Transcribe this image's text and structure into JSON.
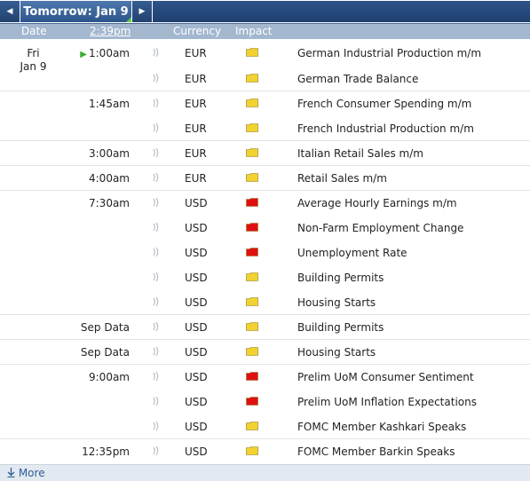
{
  "nav": {
    "day_label": "Tomorrow: Jan 9",
    "prev_arrow": "◀",
    "next_arrow": "▶"
  },
  "columns": {
    "date": "Date",
    "time": "2:39pm",
    "currency": "Currency",
    "impact": "Impact"
  },
  "date": {
    "day": "Fri",
    "date": "Jan 9"
  },
  "impact_colors": {
    "low": "#f2d230",
    "high": "#e01010"
  },
  "events": [
    {
      "time": "1:00am",
      "current": true,
      "currency": "EUR",
      "impact": "low",
      "event": "German Industrial Production m/m",
      "group_start": true
    },
    {
      "time": "",
      "currency": "EUR",
      "impact": "low",
      "event": "German Trade Balance",
      "group_start": false
    },
    {
      "time": "1:45am",
      "currency": "EUR",
      "impact": "low",
      "event": "French Consumer Spending m/m",
      "group_start": true
    },
    {
      "time": "",
      "currency": "EUR",
      "impact": "low",
      "event": "French Industrial Production m/m",
      "group_start": false
    },
    {
      "time": "3:00am",
      "currency": "EUR",
      "impact": "low",
      "event": "Italian Retail Sales m/m",
      "group_start": true
    },
    {
      "time": "4:00am",
      "currency": "EUR",
      "impact": "low",
      "event": "Retail Sales m/m",
      "group_start": true
    },
    {
      "time": "7:30am",
      "currency": "USD",
      "impact": "high",
      "event": "Average Hourly Earnings m/m",
      "group_start": true
    },
    {
      "time": "",
      "currency": "USD",
      "impact": "high",
      "event": "Non-Farm Employment Change",
      "group_start": false
    },
    {
      "time": "",
      "currency": "USD",
      "impact": "high",
      "event": "Unemployment Rate",
      "group_start": false
    },
    {
      "time": "",
      "currency": "USD",
      "impact": "low",
      "event": "Building Permits",
      "group_start": false
    },
    {
      "time": "",
      "currency": "USD",
      "impact": "low",
      "event": "Housing Starts",
      "group_start": false
    },
    {
      "time": "Sep Data",
      "currency": "USD",
      "impact": "low",
      "event": "Building Permits",
      "group_start": true
    },
    {
      "time": "Sep Data",
      "currency": "USD",
      "impact": "low",
      "event": "Housing Starts",
      "group_start": true
    },
    {
      "time": "9:00am",
      "currency": "USD",
      "impact": "high",
      "event": "Prelim UoM Consumer Sentiment",
      "group_start": true
    },
    {
      "time": "",
      "currency": "USD",
      "impact": "high",
      "event": "Prelim UoM Inflation Expectations",
      "group_start": false
    },
    {
      "time": "",
      "currency": "USD",
      "impact": "low",
      "event": "FOMC Member Kashkari Speaks",
      "group_start": false
    },
    {
      "time": "12:35pm",
      "currency": "USD",
      "impact": "low",
      "event": "FOMC Member Barkin Speaks",
      "group_start": true
    }
  ],
  "footer": {
    "more_label": "More"
  }
}
